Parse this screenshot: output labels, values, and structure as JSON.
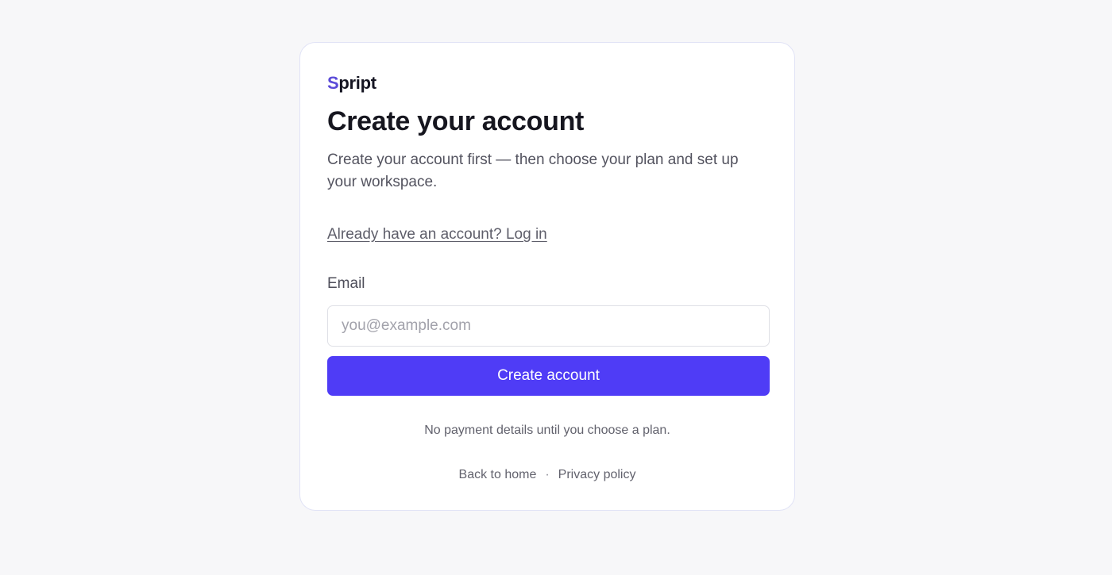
{
  "brand": {
    "logo_initial": "S",
    "logo_rest": "pript",
    "accent_color": "#5b4bd8"
  },
  "signup": {
    "title": "Create your account",
    "subtitle": "Create your account first — then choose your plan and set up your workspace.",
    "login_link": "Already have an account? Log in",
    "email_label": "Email",
    "email_placeholder": "you@example.com",
    "email_value": "",
    "submit_label": "Create account",
    "submit_color": "#4f3cf6",
    "note": "No payment details until you choose a plan."
  },
  "footer": {
    "back_home": "Back to home",
    "separator": "·",
    "privacy": "Privacy policy"
  }
}
